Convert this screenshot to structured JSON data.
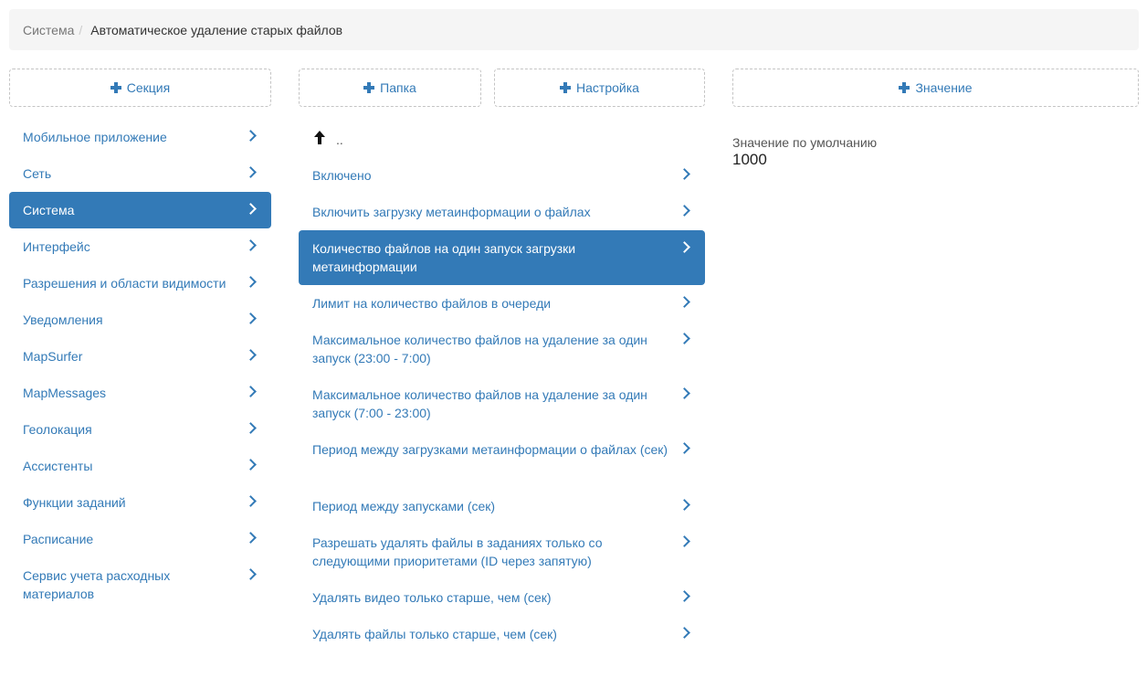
{
  "breadcrumb": {
    "parent": "Система",
    "separator": "/",
    "current": "Автоматическое удаление старых файлов"
  },
  "buttons": {
    "section": "Секция",
    "folder": "Папка",
    "setting": "Настройка",
    "value": "Значение"
  },
  "sections": [
    {
      "label": "Мобильное приложение"
    },
    {
      "label": "Сеть"
    },
    {
      "label": "Система",
      "active": true
    },
    {
      "label": "Интерфейс"
    },
    {
      "label": "Разрешения и области видимости"
    },
    {
      "label": "Уведомления"
    },
    {
      "label": "MapSurfer"
    },
    {
      "label": "MapMessages"
    },
    {
      "label": "Геолокация"
    },
    {
      "label": "Ассистенты"
    },
    {
      "label": "Функции заданий"
    },
    {
      "label": "Расписание"
    },
    {
      "label": "Сервис учета расходных материалов"
    }
  ],
  "up": {
    "label": ".."
  },
  "settings": [
    {
      "label": "Включено"
    },
    {
      "label": "Включить загрузку метаинформации о файлах"
    },
    {
      "label": "Количество файлов на один запуск загрузки метаинформации",
      "active": true
    },
    {
      "label": "Лимит на количество файлов в очереди"
    },
    {
      "label": "Максимальное количество файлов на удаление за один запуск (23:00 - 7:00)"
    },
    {
      "label": "Максимальное количество файлов на удаление за один запуск (7:00 - 23:00)"
    },
    {
      "label": "Период между загрузками метаинформации о файлах (сек)"
    },
    {
      "label": "Период между запусками (сек)"
    },
    {
      "label": "Разрешать удалять файлы в заданиях только со следующими приоритетами (ID через запятую)"
    },
    {
      "label": "Удалять видео только старше, чем (сек)"
    },
    {
      "label": "Удалять файлы только старше, чем (сек)"
    }
  ],
  "value_panel": {
    "label": "Значение по умолчанию",
    "value": "1000"
  },
  "colors": {
    "accent": "#337ab7",
    "breadcrumb_bg": "#f5f5f5"
  },
  "icons": {
    "plus": "plus-icon",
    "chevron": "chevron-right-icon",
    "up": "arrow-up-icon"
  }
}
